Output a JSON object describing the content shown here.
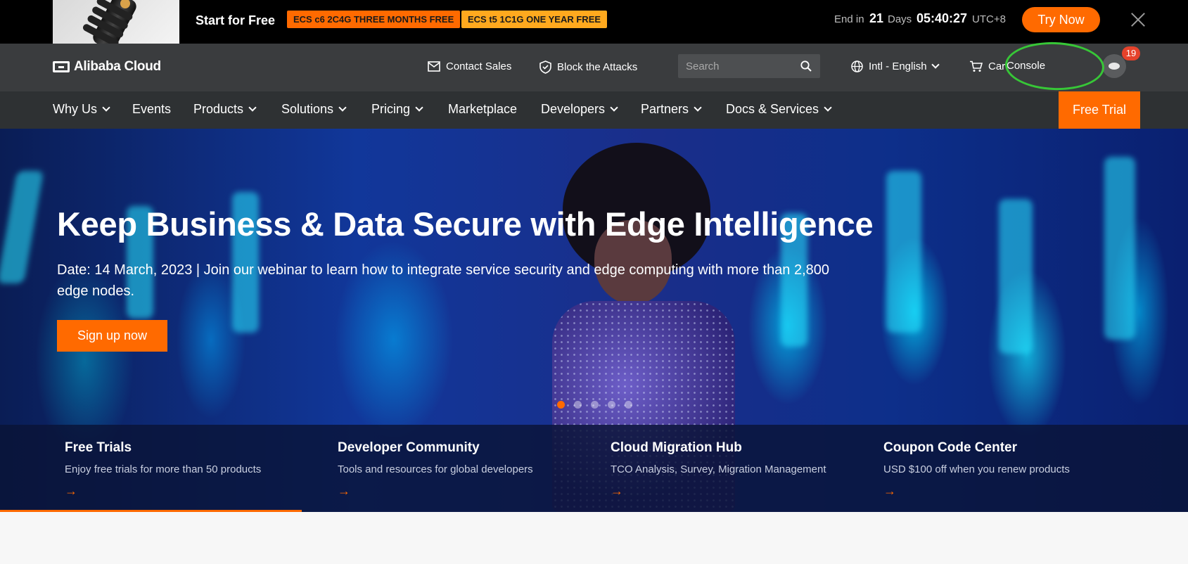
{
  "promo": {
    "start_label": "Start for Free",
    "tags": [
      "ECS c6 2C4G THREE MONTHS FREE",
      "ECS t5 1C1G ONE YEAR FREE"
    ],
    "end_in_label": "End in",
    "days_number": "21",
    "days_label": "Days",
    "countdown": "05:40:27",
    "timezone": "UTC+8",
    "try_now_label": "Try Now"
  },
  "header": {
    "logo_text": "Alibaba Cloud",
    "contact_sales": "Contact Sales",
    "block_attacks": "Block the Attacks",
    "search_placeholder": "Search",
    "language": "Intl - English",
    "cart": "Cart",
    "console": "Console",
    "notification_count": "19"
  },
  "nav": {
    "items": [
      "Why Us",
      "Events",
      "Products",
      "Solutions",
      "Pricing",
      "Marketplace",
      "Developers",
      "Partners",
      "Docs & Services"
    ],
    "free_trial": "Free Trial"
  },
  "hero": {
    "title": "Keep Business & Data Secure with Edge Intelligence",
    "description": "Date: 14 March, 2023 | Join our webinar to learn how to integrate service security and edge computing with more than 2,800 edge nodes.",
    "cta": "Sign up now",
    "slide_count": 5,
    "active_slide": 1
  },
  "cards": [
    {
      "title": "Free Trials",
      "desc": "Enjoy free trials for more than 50 products",
      "arrow": "→"
    },
    {
      "title": "Developer Community",
      "desc": "Tools and resources for global developers",
      "arrow": "→"
    },
    {
      "title": "Cloud Migration Hub",
      "desc": "TCO Analysis, Survey, Migration Management",
      "arrow": "→"
    },
    {
      "title": "Coupon Code Center",
      "desc": "USD $100 off when you renew products",
      "arrow": "→"
    }
  ],
  "colors": {
    "accent": "#ff6a00",
    "header_bg": "#3a3c3e",
    "nav_bg": "#2e3133",
    "highlight_ring": "#37c737"
  },
  "icons": [
    "mail-icon",
    "shield-icon",
    "search-icon",
    "globe-icon",
    "cart-icon",
    "close-icon",
    "chevron-down-icon",
    "arrow-right-icon"
  ]
}
